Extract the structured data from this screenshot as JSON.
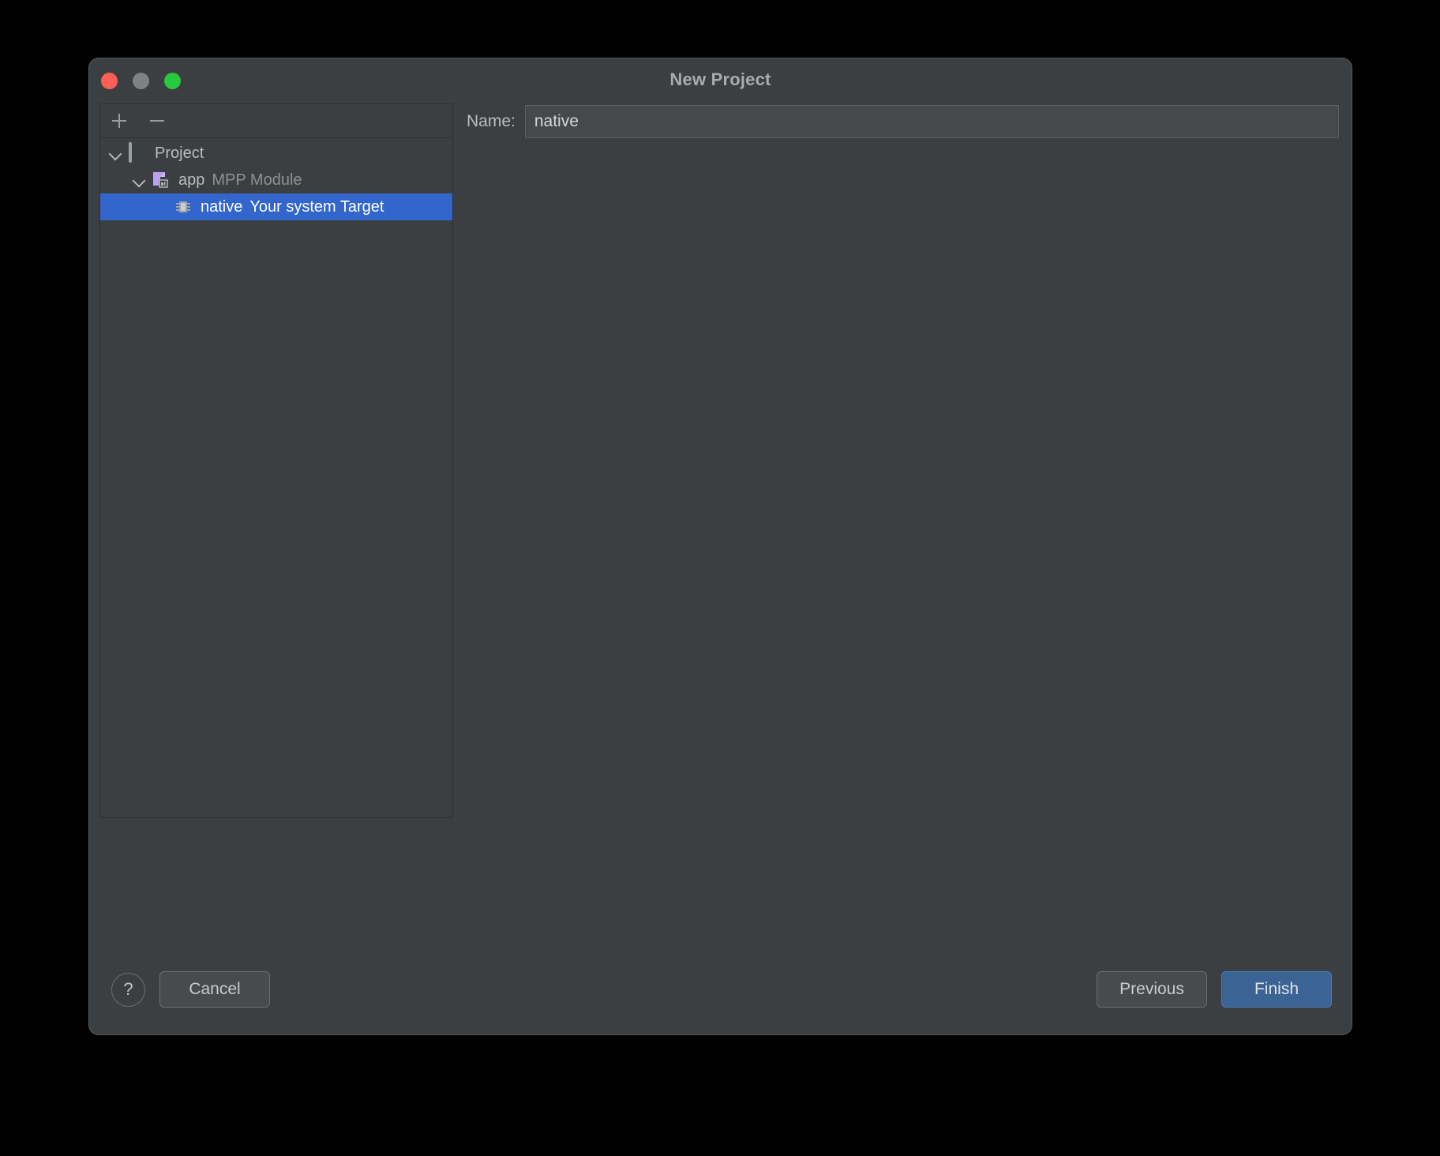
{
  "window": {
    "title": "New Project",
    "traffic_lights": [
      {
        "name": "close",
        "color": "#ff5f57"
      },
      {
        "name": "minimize",
        "color": "#7f8183"
      },
      {
        "name": "zoom",
        "color": "#28c840"
      }
    ]
  },
  "tree_toolbar": {
    "add_label": "+",
    "remove_label": "−"
  },
  "tree": {
    "rows": [
      {
        "label": "Project",
        "sublabel": "",
        "icon": "project-icon",
        "depth": 0,
        "expanded": true,
        "selected": false
      },
      {
        "label": "app",
        "sublabel": "MPP Module",
        "icon": "module-icon",
        "depth": 1,
        "expanded": true,
        "selected": false
      },
      {
        "label": "native",
        "sublabel": "Your system Target",
        "icon": "target-chip-icon",
        "depth": 2,
        "expanded": false,
        "selected": true
      }
    ]
  },
  "details": {
    "name_label": "Name:",
    "name_value": "native",
    "name_placeholder": ""
  },
  "footer": {
    "help_label": "?",
    "cancel_label": "Cancel",
    "previous_label": "Previous",
    "finish_label": "Finish"
  },
  "colors": {
    "background": "#3c3f41",
    "selection": "#3366cc",
    "primary_button": "#3b6394",
    "field_background": "#45494a"
  }
}
